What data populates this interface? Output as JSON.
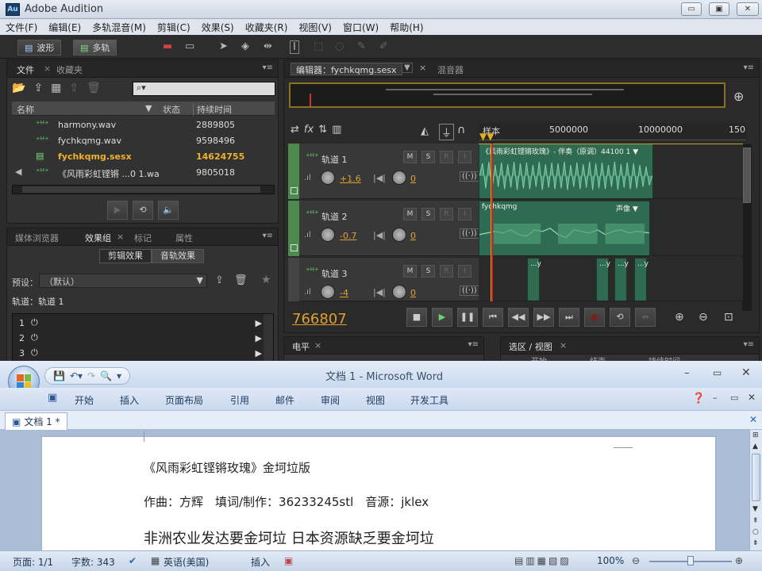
{
  "audition": {
    "app_badge": "Au",
    "title": "Adobe Audition",
    "menu": [
      "文件(F)",
      "编辑(E)",
      "多轨混音(M)",
      "剪辑(C)",
      "效果(S)",
      "收藏夹(R)",
      "视图(V)",
      "窗口(W)",
      "帮助(H)"
    ],
    "mode_waveform": "波形",
    "mode_multitrack": "多轨",
    "files_panel": {
      "tab_files": "文件",
      "tab_favorites": "收藏夹",
      "col_name": "名称",
      "col_status": "状态",
      "col_duration": "持续时间",
      "rows": [
        {
          "name": "harmony.wav",
          "duration": "2889805"
        },
        {
          "name": "fychkqmg.wav",
          "duration": "9598496"
        },
        {
          "name": "fychkqmg.sesx",
          "duration": "14624755"
        },
        {
          "name": "《风雨彩虹铿锵 ...0 1.wa",
          "duration": "9805018"
        }
      ]
    },
    "effects_panel": {
      "tabs": [
        "媒体浏览器",
        "效果组",
        "标记",
        "属性"
      ],
      "btn_clip_effects": "剪辑效果",
      "btn_track_effects": "音轨效果",
      "preset_label": "预设：",
      "preset_value": "（默认）",
      "track_label": "轨道：轨道 1",
      "slots": [
        "1",
        "2",
        "3"
      ]
    },
    "editor": {
      "tab_editor": "编辑器：fychkqmg.sesx",
      "tab_mixer": "混音器",
      "ruler_label": "样本",
      "ruler_ticks": [
        "5000000",
        "10000000",
        "150"
      ],
      "timecode": "766807",
      "tracks": [
        {
          "name": "轨道 1",
          "volume": "+1.6",
          "pan": "0",
          "clip": "《风雨彩虹铿锵玫瑰》- 伴奏（原调）44100 1 ▼"
        },
        {
          "name": "轨道 2",
          "volume": "-0.7",
          "pan": "0",
          "clip": "fychkqmg",
          "clip_tag": "声像 ▼"
        },
        {
          "name": "轨道 3",
          "volume": "-4",
          "pan": "0",
          "clip": "...y"
        }
      ],
      "track_btns": [
        "M",
        "S",
        "R",
        "I"
      ]
    },
    "levels_tab": "电平",
    "selection_tab": "选区 / 视图",
    "selection_cols": [
      "开始",
      "结束",
      "持续时间"
    ]
  },
  "word": {
    "title": "文档 1 - Microsoft Word",
    "ribbon_tabs": [
      "开始",
      "插入",
      "页面布局",
      "引用",
      "邮件",
      "审阅",
      "视图",
      "开发工具"
    ],
    "doc_tab": "文档 1 *",
    "lines": [
      "《风雨彩虹铿锵玫瑰》金坷垃版",
      "作曲：方辉　填词/制作：36233245stl　音源：jklex",
      "非洲农业发达要金坷垃 日本资源缺乏要金坷垃"
    ],
    "status": {
      "page": "页面: 1/1",
      "words": "字数: 343",
      "language": "英语(美国)",
      "insert": "插入",
      "zoom": "100%"
    }
  }
}
